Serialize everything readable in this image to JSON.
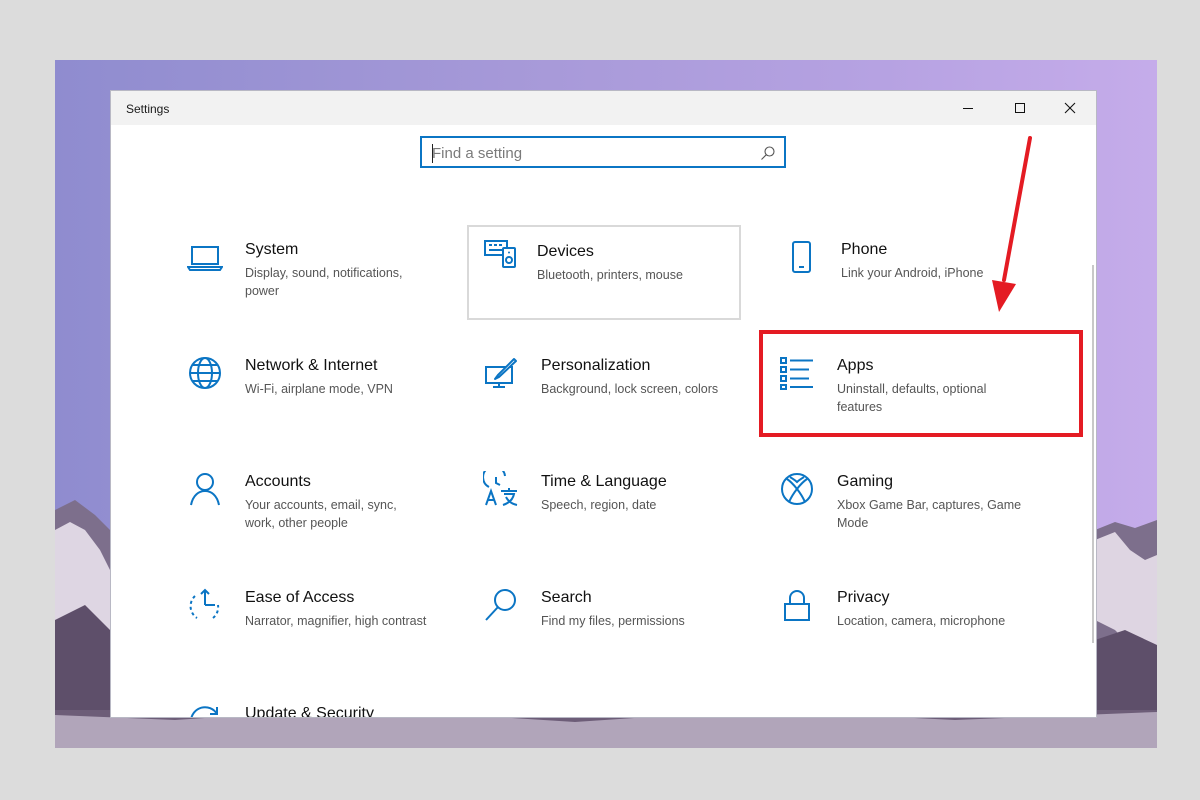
{
  "window": {
    "title": "Settings",
    "controls": [
      "minimize",
      "maximize",
      "close"
    ]
  },
  "search": {
    "placeholder": "Find a setting",
    "icon": "search-icon"
  },
  "tiles": [
    {
      "name": "System",
      "desc": "Display, sound, notifications, power",
      "icon": "laptop-icon"
    },
    {
      "name": "Devices",
      "desc": "Bluetooth, printers, mouse",
      "icon": "keyboard-speaker-icon"
    },
    {
      "name": "Phone",
      "desc": "Link your Android, iPhone",
      "icon": "phone-icon"
    },
    {
      "name": "Network & Internet",
      "desc": "Wi-Fi, airplane mode, VPN",
      "icon": "globe-icon"
    },
    {
      "name": "Personalization",
      "desc": "Background, lock screen, colors",
      "icon": "paintbrush-icon"
    },
    {
      "name": "Apps",
      "desc": "Uninstall, defaults, optional features",
      "icon": "apps-list-icon"
    },
    {
      "name": "Accounts",
      "desc": "Your accounts, email, sync, work, other people",
      "icon": "person-icon"
    },
    {
      "name": "Time & Language",
      "desc": "Speech, region, date",
      "icon": "time-language-icon"
    },
    {
      "name": "Gaming",
      "desc": "Xbox Game Bar, captures, Game Mode",
      "icon": "xbox-icon"
    },
    {
      "name": "Ease of Access",
      "desc": "Narrator, magnifier, high contrast",
      "icon": "ease-of-access-icon"
    },
    {
      "name": "Search",
      "desc": "Find my files, permissions",
      "icon": "magnifier-icon"
    },
    {
      "name": "Privacy",
      "desc": "Location, camera, microphone",
      "icon": "lock-icon"
    },
    {
      "name": "Update & Security",
      "desc": "",
      "icon": "update-icon"
    }
  ],
  "colors": {
    "accent": "#0b75c4",
    "annotation": "#e41b23",
    "hover_border": "#d9d9d9"
  },
  "annotation": {
    "highlighted_tile": "Apps"
  }
}
